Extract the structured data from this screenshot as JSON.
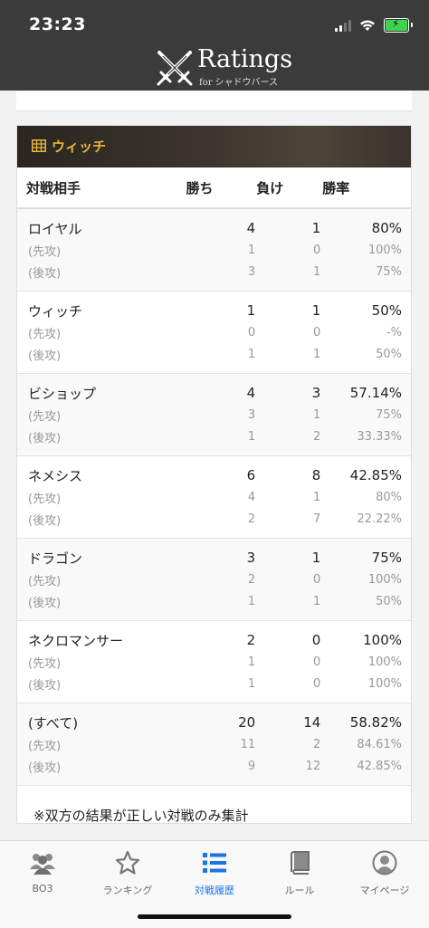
{
  "status_bar": {
    "time": "23:23"
  },
  "header": {
    "logo_text": "Ratings",
    "logo_sub_prefix": "for",
    "logo_sub": "シャドウバース"
  },
  "card": {
    "title": "ウィッチ",
    "columns": {
      "opponent": "対戦相手",
      "wins": "勝ち",
      "losses": "負け",
      "rate": "勝率"
    },
    "rows": [
      {
        "name": "ロイヤル",
        "wins": "4",
        "losses": "1",
        "rate": "80%",
        "first": {
          "label": "(先攻)",
          "wins": "1",
          "losses": "0",
          "rate": "100%"
        },
        "second": {
          "label": "(後攻)",
          "wins": "3",
          "losses": "1",
          "rate": "75%"
        }
      },
      {
        "name": "ウィッチ",
        "wins": "1",
        "losses": "1",
        "rate": "50%",
        "first": {
          "label": "(先攻)",
          "wins": "0",
          "losses": "0",
          "rate": "-%"
        },
        "second": {
          "label": "(後攻)",
          "wins": "1",
          "losses": "1",
          "rate": "50%"
        }
      },
      {
        "name": "ビショップ",
        "wins": "4",
        "losses": "3",
        "rate": "57.14%",
        "first": {
          "label": "(先攻)",
          "wins": "3",
          "losses": "1",
          "rate": "75%"
        },
        "second": {
          "label": "(後攻)",
          "wins": "1",
          "losses": "2",
          "rate": "33.33%"
        }
      },
      {
        "name": "ネメシス",
        "wins": "6",
        "losses": "8",
        "rate": "42.85%",
        "first": {
          "label": "(先攻)",
          "wins": "4",
          "losses": "1",
          "rate": "80%"
        },
        "second": {
          "label": "(後攻)",
          "wins": "2",
          "losses": "7",
          "rate": "22.22%"
        }
      },
      {
        "name": "ドラゴン",
        "wins": "3",
        "losses": "1",
        "rate": "75%",
        "first": {
          "label": "(先攻)",
          "wins": "2",
          "losses": "0",
          "rate": "100%"
        },
        "second": {
          "label": "(後攻)",
          "wins": "1",
          "losses": "1",
          "rate": "50%"
        }
      },
      {
        "name": "ネクロマンサー",
        "wins": "2",
        "losses": "0",
        "rate": "100%",
        "first": {
          "label": "(先攻)",
          "wins": "1",
          "losses": "0",
          "rate": "100%"
        },
        "second": {
          "label": "(後攻)",
          "wins": "1",
          "losses": "0",
          "rate": "100%"
        }
      },
      {
        "name": "(すべて)",
        "wins": "20",
        "losses": "14",
        "rate": "58.82%",
        "first": {
          "label": "(先攻)",
          "wins": "11",
          "losses": "2",
          "rate": "84.61%"
        },
        "second": {
          "label": "(後攻)",
          "wins": "9",
          "losses": "12",
          "rate": "42.85%"
        }
      }
    ],
    "note": "※双方の結果が正しい対戦のみ集計"
  },
  "tabbar": {
    "tabs": [
      {
        "label": "BO3",
        "icon": "users-icon"
      },
      {
        "label": "ランキング",
        "icon": "star-icon"
      },
      {
        "label": "対戦履歴",
        "icon": "list-icon",
        "active": true
      },
      {
        "label": "ルール",
        "icon": "book-icon"
      },
      {
        "label": "マイページ",
        "icon": "user-circle-icon"
      }
    ]
  },
  "colors": {
    "accent": "#1a73e8",
    "header_title": "#e7b53a",
    "topbar": "#3b3b3b"
  }
}
